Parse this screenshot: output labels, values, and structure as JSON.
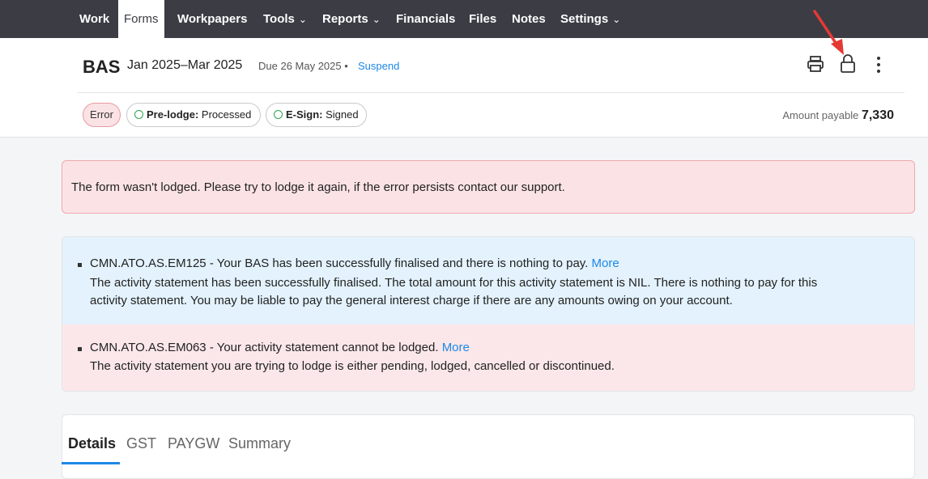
{
  "nav": {
    "items": [
      {
        "label": "Work"
      },
      {
        "label": "Forms"
      },
      {
        "label": "Workpapers"
      },
      {
        "label": "Tools"
      },
      {
        "label": "Reports"
      },
      {
        "label": "Financials"
      },
      {
        "label": "Files"
      },
      {
        "label": "Notes"
      },
      {
        "label": "Settings"
      }
    ],
    "active": "Forms",
    "dropdown_chevron": "⌄"
  },
  "header": {
    "title": "BAS",
    "period": "Jan 2025–Mar 2025",
    "due": "Due 26 May 2025 •",
    "suspend_label": "Suspend",
    "icons": [
      "printer-icon",
      "lock-icon",
      "more-vertical-icon"
    ]
  },
  "status": {
    "error_badge": "Error",
    "prelodge_label": "Pre-lodge:",
    "prelodge_value": "Processed",
    "esign_label": "E-Sign:",
    "esign_value": "Signed",
    "amount_label": "Amount payable",
    "amount_value": "7,330"
  },
  "error_banner": {
    "text": "The form wasn't lodged. Please try to lodge it again, if the error persists contact our support."
  },
  "messages": [
    {
      "code": "CMN.ATO.AS.EM125",
      "summary": " - Your BAS has been successfully finalised and there is nothing to pay.",
      "more": "More",
      "detail_1": "The activity statement has been successfully finalised. The total amount for this activity statement is NIL. There is nothing to pay for this",
      "detail_2": "activity statement. You may be liable to pay the general interest charge if there are any amounts owing on your account."
    },
    {
      "code": "CMN.ATO.AS.EM063",
      "summary": " - Your activity statement cannot be lodged.",
      "more": "More",
      "detail_1": "The activity statement you are trying to lodge is either pending, lodged, cancelled or discontinued."
    }
  ],
  "tabs": [
    {
      "label": "Details"
    },
    {
      "label": "GST"
    },
    {
      "label": "PAYGW"
    },
    {
      "label": "Summary"
    }
  ],
  "colors": {
    "nav_bg": "#3b3c44",
    "link": "#1e88e5",
    "error_bg": "#fbe3e5",
    "info_bg": "#e3f2fc",
    "annotation_arrow": "#e53935"
  }
}
